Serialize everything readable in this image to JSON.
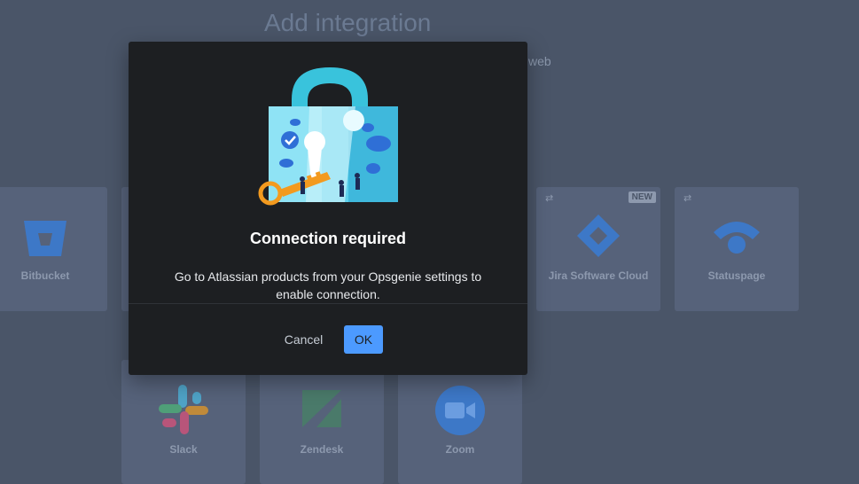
{
  "page": {
    "title": "Add integration",
    "subtitle_fragment": "web"
  },
  "integrations": [
    {
      "name": "Bitbucket",
      "icon": "bitbucket-icon"
    },
    {
      "name": "Jira Software Cloud",
      "icon": "jira-software-icon",
      "badge": "NEW"
    },
    {
      "name": "Statuspage",
      "icon": "statuspage-icon"
    },
    {
      "name": "Slack",
      "icon": "slack-icon"
    },
    {
      "name": "Zendesk",
      "icon": "zendesk-icon"
    },
    {
      "name": "Zoom",
      "icon": "zoom-icon"
    }
  ],
  "modal": {
    "title": "Connection required",
    "body": "Go to Atlassian products from your Opsgenie settings to enable connection.",
    "cancel_label": "Cancel",
    "ok_label": "OK"
  },
  "colors": {
    "backdrop": "#4a5568",
    "modal_bg": "#1d1f22",
    "primary": "#4c9aff"
  }
}
